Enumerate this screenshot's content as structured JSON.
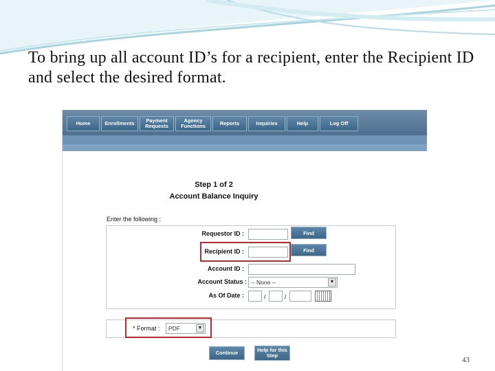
{
  "slide": {
    "caption": "To bring up all account ID’s for a recipient, enter the Recipient ID and select the desired format.",
    "page_number": "43"
  },
  "nav": {
    "items": [
      {
        "label": "Home"
      },
      {
        "label": "Enrollments"
      },
      {
        "label": "Payment Requests"
      },
      {
        "label": "Agency Functions"
      },
      {
        "label": "Reports"
      },
      {
        "label": "Inquiries"
      },
      {
        "label": "Help"
      },
      {
        "label": "Log Off"
      }
    ]
  },
  "step": {
    "title": "Step 1 of 2",
    "subtitle": "Account Balance Inquiry"
  },
  "form": {
    "intro": "Enter the following :",
    "requestor_label": "Requestor ID :",
    "recipient_label": "Recipient ID :",
    "account_label": "Account ID :",
    "status_label": "Account Status :",
    "date_label": "As Of Date :",
    "find_label": "Find",
    "status_value": "-- None --",
    "date_separator": "/",
    "requestor_value": "",
    "recipient_value": "",
    "account_value": ""
  },
  "format": {
    "label": "* Format :",
    "value": "PDF"
  },
  "actions": {
    "continue_label": "Continue",
    "help_label": "Help for this Step"
  },
  "colors": {
    "highlight": "#c0282d",
    "nav": "#4e6f90"
  }
}
